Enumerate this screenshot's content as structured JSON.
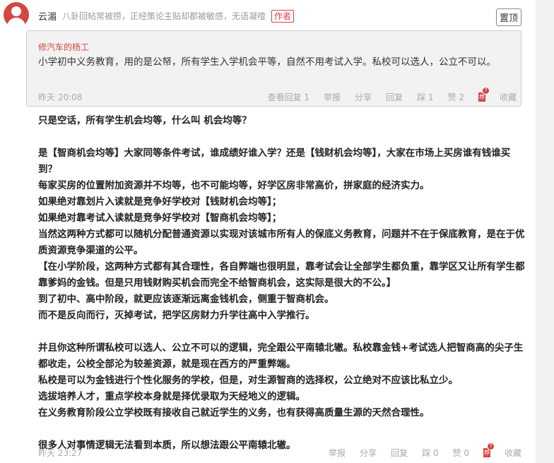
{
  "post": {
    "user": "云湄",
    "signature": "八卦回帖常被捞，正经策论主贴却都被敏感，无语凝噎",
    "author_badge": "作者",
    "pin_label": "置顶"
  },
  "quote": {
    "author": "修汽车的杨工",
    "text": "小学初中义务教育，用的是公帑，所有学生入学机会平等，自然不用考试入学。私校可以选人，公立不可以。",
    "time": "昨天 20:08",
    "actions": [
      "查看回复 1",
      "举报",
      "分享",
      "回复",
      "踩 1",
      "赞 2"
    ],
    "rec_label": "荐",
    "collect": "收藏"
  },
  "body": [
    "只是空话，所有学生机会均等，什么叫 机会均等？",
    "",
    "是【智商机会均等】大家同等条件考试，谁成绩好谁入学？还是【钱财机会均等】，大家在市场上买房谁有钱谁买到？",
    "每家买房的位置附加资源并不均等，也不可能均等，好学区房非常高价，拼家庭的经济实力。",
    "如果绝对靠划片入读就是竞争好学校对【钱财机会均等】；",
    "如果绝对靠考试入读就是竞争好学校对【智商机会均等】；",
    "当然这两种方式都可以随机分配普通资源以实现对该城市所有人的保底义务教育，问题并不在于保底教育，是在于优质资源竞争渠道的公平。",
    "【在小学阶段，这两种方式都有其合理性，各自弊端也很明显，靠考试会让全部学生都负重，靠学区又让所有学生都靠爹妈的金钱。但是只用钱财购买机会而完全不给智商机会，这实际是很大的不公。】",
    "到了初中、高中阶段，就更应该逐渐远离金钱机会，侧重于智商机会。",
    "而不是反向而行，灭掉考试，把学区房财力升学往高中入学推行。",
    "",
    "并且你这种所谓私校可以选人、公立不可以的逻辑，完全跟公平南辕北辙。私校靠金钱+考试选人把智商高的尖子生都收走，公校全部沦为较差资源，就是现在西方的严重弊端。",
    "私校是可以为金钱进行个性化服务的学校，但是，对生源智商的选择权，公立绝对不应该比私立少。",
    "选拔培养人才，重点学校本身就是择优录取为天经地义的逻辑。",
    "在义务教育阶段公立学校既有接收自己就近学生的义务，也有获得高质量生源的天然合理性。",
    "",
    "很多人对事情逻辑无法看到本质，所以想法跟公平南辕北辙。"
  ],
  "footer": {
    "time": "昨天 23:27",
    "actions": [
      "举报",
      "分享",
      "回复",
      "踩 0",
      "赞 0"
    ],
    "rec_label": "荐",
    "collect": "收藏"
  }
}
